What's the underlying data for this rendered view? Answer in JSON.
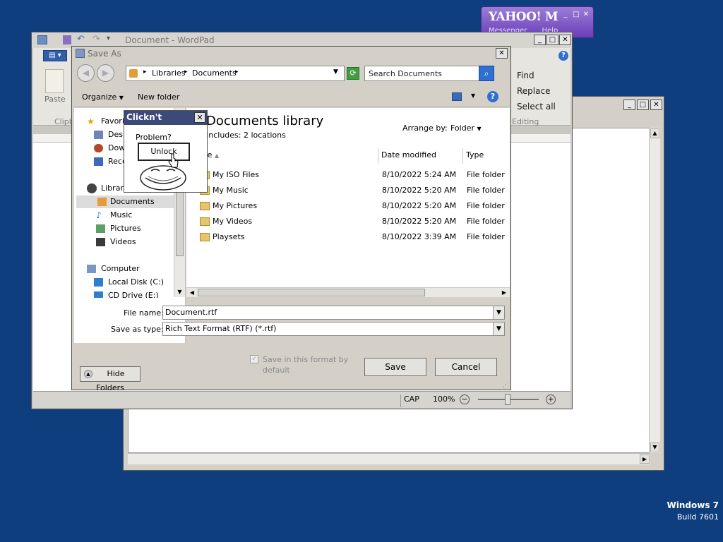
{
  "yahoo": {
    "logo": "YAHOO!",
    "logo_suffix": "M",
    "menu": [
      "Messenger",
      "Help"
    ]
  },
  "wordpad": {
    "title": "Document - WordPad",
    "ribbon": {
      "paste_label": "Paste",
      "clipboard_group": "Clipb",
      "find": "Find",
      "replace": "Replace",
      "select_all": "Select all",
      "editing_group": "Editing"
    },
    "status": {
      "caps": "CAP",
      "zoom": "100%",
      "zoom_out": "−",
      "zoom_in": "+"
    }
  },
  "saveas": {
    "title": "Save As",
    "breadcrumb": [
      "Libraries",
      "Documents"
    ],
    "search_placeholder": "Search Documents",
    "cmd": {
      "organize": "Organize",
      "new_folder": "New folder"
    },
    "library": {
      "title": "Documents library",
      "subtitle": "Includes:  2 locations",
      "arrange_label": "Arrange by:",
      "arrange_value": "Folder"
    },
    "nav": {
      "favorites": "Favorites",
      "desktop": "Desktop",
      "downloads": "Downloads",
      "recent": "Recent Places",
      "libraries": "Libraries",
      "documents": "Documents",
      "music": "Music",
      "pictures": "Pictures",
      "videos": "Videos",
      "computer": "Computer",
      "local_disk": "Local Disk (C:)",
      "cd_drive": "CD Drive (E:)"
    },
    "columns": [
      "Name",
      "Date modified",
      "Type"
    ],
    "files": [
      {
        "name": "My ISO Files",
        "date": "8/10/2022 5:24 AM",
        "type": "File folder"
      },
      {
        "name": "My Music",
        "date": "8/10/2022 5:20 AM",
        "type": "File folder"
      },
      {
        "name": "My Pictures",
        "date": "8/10/2022 5:20 AM",
        "type": "File folder"
      },
      {
        "name": "My Videos",
        "date": "8/10/2022 5:20 AM",
        "type": "File folder"
      },
      {
        "name": "Playsets",
        "date": "8/10/2022 3:39 AM",
        "type": "File folder"
      }
    ],
    "file_name_label": "File name:",
    "file_name_value": "Document.rtf",
    "save_type_label": "Save as type:",
    "save_type_value": "Rich Text Format (RTF) (*.rtf)",
    "save_format_checkbox": "Save in this format by default",
    "hide_folders": "Hide Folders",
    "save_button": "Save",
    "cancel_button": "Cancel"
  },
  "clickn": {
    "title": "Clickn't",
    "problem": "Problem?",
    "unlock": "Unlock"
  },
  "desktop": {
    "os_name": "Windows 7",
    "build": "Build 7601"
  }
}
